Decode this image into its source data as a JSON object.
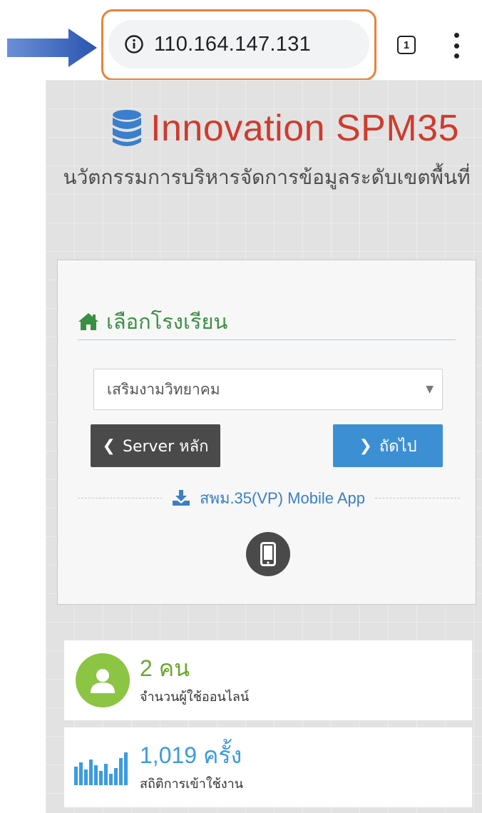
{
  "browser": {
    "url": "110.164.147.131",
    "tab_count": "1",
    "annotation_color": "#e8833a",
    "arrow_color": "#2f5fb8"
  },
  "header": {
    "title": "Innovation SPM35",
    "subtitle": "นวัตกรรมการบริหารจัดการข้อมูลระดับเขตพื้นที่",
    "title_color": "#cf3b2d"
  },
  "panel": {
    "heading": "เลือกโรงเรียน",
    "select": {
      "selected": "เสริมงามวิทยาคม",
      "caret": "▼"
    },
    "back_button": "Server หลัก",
    "next_button": "ถัดไป",
    "app_link": "สพม.35(VP) Mobile App"
  },
  "stats": [
    {
      "value": "2 คน",
      "label": "จำนวนผู้ใช้ออนไลน์",
      "color": "#6ca72e",
      "icon": "user-icon"
    },
    {
      "value": "1,019 ครั้ง",
      "label": "สถิติการเข้าใช้งาน",
      "color": "#3b9be0",
      "icon": "bar-chart-icon"
    }
  ]
}
